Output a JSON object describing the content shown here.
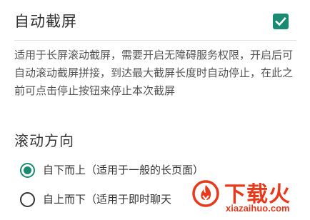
{
  "setting": {
    "title": "自动截屏",
    "checked": true,
    "description": "适用于长屏滚动截屏，需要开启无障碍服务权限，开启后可自动滚动截屏拼接，到达最大截屏长度时自动停止，在此之前可点击停止按钮来停止本次截屏"
  },
  "direction": {
    "title": "滚动方向",
    "options": [
      {
        "label": "自下而上（适用于一般的长页面）",
        "selected": true
      },
      {
        "label": "自上而下（适用于即时聊天",
        "selected": false
      }
    ]
  },
  "watermark": {
    "brand": "下载火",
    "site": "xiazaihuo.com"
  },
  "colors": {
    "accent": "#1a8a73",
    "watermark": "#e8391c"
  }
}
